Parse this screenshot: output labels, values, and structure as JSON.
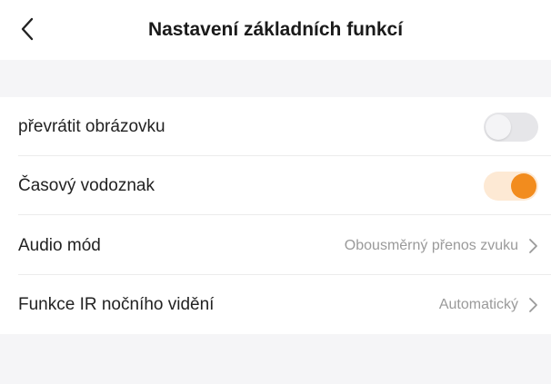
{
  "header": {
    "title": "Nastavení základních funkcí",
    "back_icon": "chevron-left-icon"
  },
  "settings": {
    "flip_screen": {
      "label": "převrátit obrázovku",
      "enabled": false
    },
    "time_watermark": {
      "label": "Časový vodoznak",
      "enabled": true
    },
    "audio_mode": {
      "label": "Audio mód",
      "value": "Obousměrný přenos zvuku"
    },
    "ir_night_vision": {
      "label": "Funkce IR nočního vidění",
      "value": "Automatický"
    }
  },
  "colors": {
    "accent": "#f28c1e",
    "accent_track": "#fde9d4",
    "toggle_off_track": "#e6e6e9",
    "section_background": "#f5f5f7",
    "secondary_text": "#9a9a9a"
  }
}
